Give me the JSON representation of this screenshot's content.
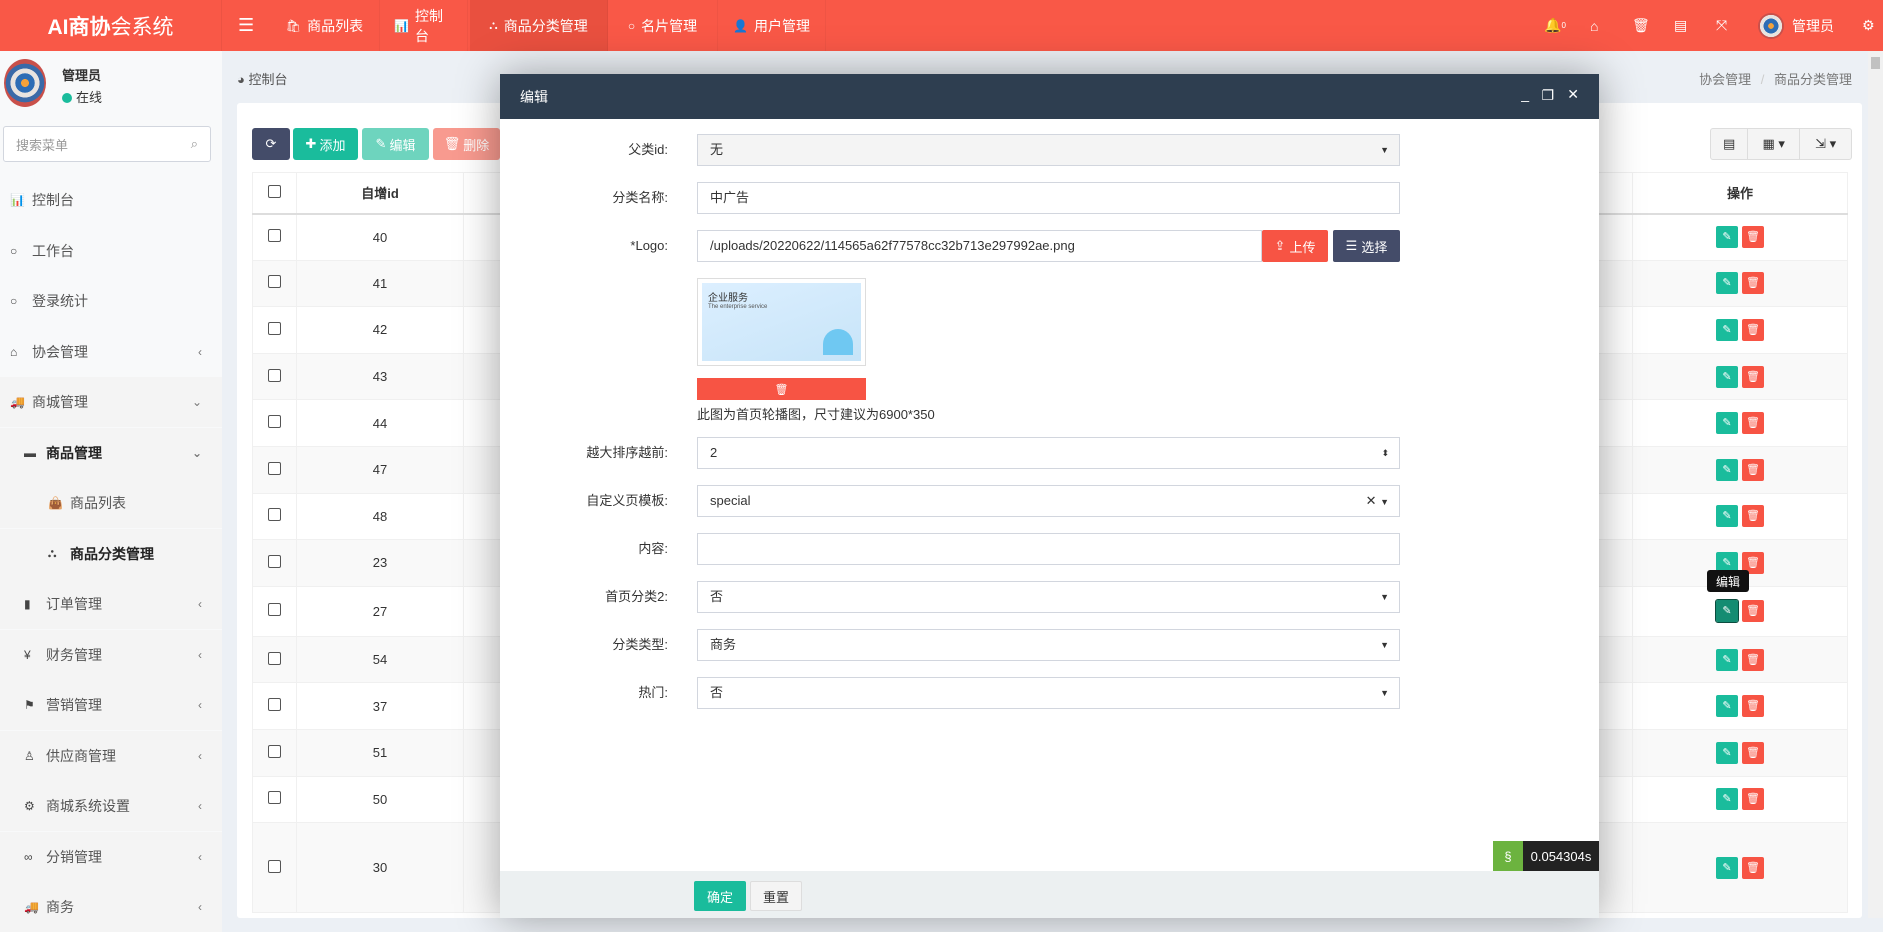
{
  "header": {
    "logo_bold": "AI商协",
    "logo_rest": "会系统",
    "nav": [
      {
        "label": "商品列表",
        "icon": "shopping-bag-icon",
        "glyph": "🛍"
      },
      {
        "label": "控制台",
        "icon": "bar-chart-icon",
        "glyph": "📊"
      },
      {
        "label": "商品分类管理",
        "icon": "sitemap-icon",
        "glyph": "⛬"
      },
      {
        "label": "名片管理",
        "icon": "circle-icon",
        "glyph": "○"
      },
      {
        "label": "用户管理",
        "icon": "user-icon",
        "glyph": "👤"
      }
    ],
    "notification_count": "0",
    "user_name": "管理员"
  },
  "sidebar": {
    "user_name": "管理员",
    "status": "在线",
    "search_placeholder": "搜索菜单",
    "items": [
      {
        "label": "控制台",
        "icon": "bar-chart-icon",
        "glyph": "📊"
      },
      {
        "label": "工作台",
        "icon": "circle-icon",
        "glyph": "○"
      },
      {
        "label": "登录统计",
        "icon": "circle-icon",
        "glyph": "○"
      },
      {
        "label": "协会管理",
        "icon": "home-icon",
        "glyph": "⌂",
        "caret": "‹"
      },
      {
        "label": "商城管理",
        "icon": "truck-icon",
        "glyph": "🚚",
        "caret": "⌄"
      },
      {
        "label": "商品管理",
        "icon": "archive-icon",
        "glyph": "▬",
        "caret": "⌄"
      },
      {
        "label": "商品列表",
        "icon": "shopping-bag-icon",
        "glyph": "👜"
      },
      {
        "label": "商品分类管理",
        "icon": "sitemap-icon",
        "glyph": "⛬"
      },
      {
        "label": "订单管理",
        "icon": "file-icon",
        "glyph": "▮",
        "caret": "‹"
      },
      {
        "label": "财务管理",
        "icon": "yen-icon",
        "glyph": "¥",
        "caret": "‹"
      },
      {
        "label": "营销管理",
        "icon": "flag-icon",
        "glyph": "⚑",
        "caret": "‹"
      },
      {
        "label": "供应商管理",
        "icon": "user-tie-icon",
        "glyph": "♙",
        "caret": "‹"
      },
      {
        "label": "商城系统设置",
        "icon": "cogs-icon",
        "glyph": "⚙",
        "caret": "‹"
      },
      {
        "label": "分销管理",
        "icon": "handshake-icon",
        "glyph": "∞",
        "caret": "‹"
      },
      {
        "label": "商务",
        "icon": "truck-icon",
        "glyph": "🚚",
        "caret": "‹"
      }
    ]
  },
  "breadcrumb": {
    "left": "控制台",
    "trail": [
      "协会管理",
      "商品分类管理"
    ]
  },
  "toolbar": {
    "add": "添加",
    "edit": "编辑",
    "delete": "删除"
  },
  "table": {
    "columns": [
      "自增id",
      "操作"
    ],
    "ids": [
      "40",
      "41",
      "42",
      "43",
      "44",
      "47",
      "48",
      "23",
      "27",
      "54",
      "37",
      "51",
      "50",
      "30"
    ],
    "tooltip": "编辑"
  },
  "modal": {
    "title": "编辑",
    "fields": {
      "parent_label": "父类id:",
      "parent_value": "无",
      "name_label": "分类名称:",
      "name_value": "中广告",
      "logo_label": "*Logo:",
      "logo_value": "/uploads/20220622/114565a62f77578cc32b713e297992ae.png",
      "upload": "上传",
      "choose": "选择",
      "preview_title": "企业服务",
      "preview_sub": "The enterprise service",
      "hint": "此图为首页轮播图，尺寸建议为6900*350",
      "sort_label": "越大排序越前:",
      "sort_value": "2",
      "template_label": "自定义页模板:",
      "template_value": "special",
      "content_label": "内容:",
      "content_value": "",
      "home2_label": "首页分类2:",
      "home2_value": "否",
      "type_label": "分类类型:",
      "type_value": "商务",
      "hot_label": "热门:",
      "hot_value": "否"
    },
    "confirm": "确定",
    "reset": "重置"
  },
  "debug_timer": "0.054304s",
  "colors": {
    "header": "#f95847",
    "primary": "#1abc9c",
    "danger": "#f75444",
    "modal_header": "#2e3e50",
    "dark_btn": "#444c69"
  }
}
